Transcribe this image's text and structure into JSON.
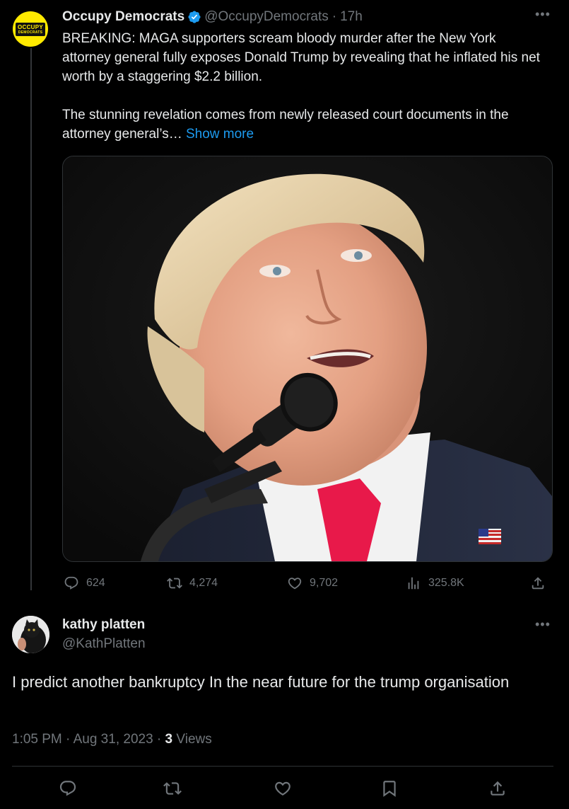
{
  "original_tweet": {
    "display_name": "Occupy Democrats",
    "handle": "@OccupyDemocrats",
    "separator": "·",
    "time": "17h",
    "avatar_text_line1": "OCCUPY",
    "avatar_text_line2": "DEMOCRATS",
    "text": "BREAKING: MAGA supporters scream bloody murder after the New York attorney general fully exposes Donald Trump by revealing that he inflated his net worth by a staggering $2.2 billion.\n\nThe stunning revelation comes from newly released court documents in the attorney general’s… ",
    "show_more": "Show more",
    "metrics": {
      "replies": "624",
      "reposts": "4,274",
      "likes": "9,702",
      "views": "325.8K"
    }
  },
  "reply": {
    "display_name": "kathy platten",
    "handle": "@KathPlatten",
    "text": "I predict another bankruptcy In the near future for the trump organisation",
    "timestamp": "1:05 PM · Aug 31, 2023 · ",
    "views_count": "3",
    "views_label": " Views"
  },
  "colors": {
    "background": "#000000",
    "text_primary": "#e7e9ea",
    "text_secondary": "#71767b",
    "link": "#1d9bf0",
    "verified": "#1d9bf0",
    "avatar_yellow": "#ffea00",
    "tie": "#e8194a"
  },
  "icons": [
    "verified-badge-icon",
    "more-icon",
    "reply-icon",
    "repost-icon",
    "like-icon",
    "views-icon",
    "share-icon",
    "bookmark-icon"
  ]
}
